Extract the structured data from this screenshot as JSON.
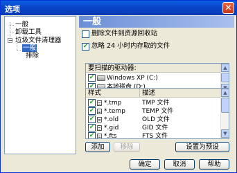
{
  "window": {
    "title": "选项",
    "close_glyph": "✕"
  },
  "tree": {
    "items": [
      {
        "label": "一般"
      },
      {
        "label": "卸载工具"
      },
      {
        "label": "垃圾文件清理器",
        "expander": "−"
      },
      {
        "label": "一般",
        "selected": true
      },
      {
        "label": "排除"
      }
    ]
  },
  "panel": {
    "header": "一般",
    "options": [
      {
        "label": "删除文件到资源回收站",
        "checked": false
      },
      {
        "label": "忽略 24 小时内存取的文件",
        "checked": true
      }
    ],
    "drives_heading": "要扫描的驱动器:",
    "drives": [
      {
        "label": "Windows XP (C:)",
        "checked": true
      },
      {
        "label": "本地磁盘 (D:)",
        "checked": true
      },
      {
        "label": "",
        "checked": true
      }
    ],
    "table": {
      "columns": [
        "样式",
        "描述"
      ],
      "rows": [
        {
          "pattern": "*.tmp",
          "desc": "TMP 文件",
          "checked": true
        },
        {
          "pattern": "*.temp",
          "desc": "TEMP 文件",
          "checked": true
        },
        {
          "pattern": "*.old",
          "desc": "OLD 文件",
          "checked": true
        },
        {
          "pattern": "*.gid",
          "desc": "GID 文件",
          "checked": true
        },
        {
          "pattern": "*.fts",
          "desc": "FTS 文件",
          "checked": true
        }
      ]
    },
    "buttons": {
      "add": "添加",
      "remove": "移除",
      "set_default": "设置为预设"
    }
  },
  "footer": {
    "ok": "确定",
    "cancel": "取消",
    "help": "帮助"
  },
  "colors": {
    "check": "#21a121",
    "selection": "#316ac5",
    "title_bar": "#0a5fe0"
  },
  "icons": {
    "close": "close-icon",
    "drive": "drive-icon",
    "file": "file-icon"
  }
}
